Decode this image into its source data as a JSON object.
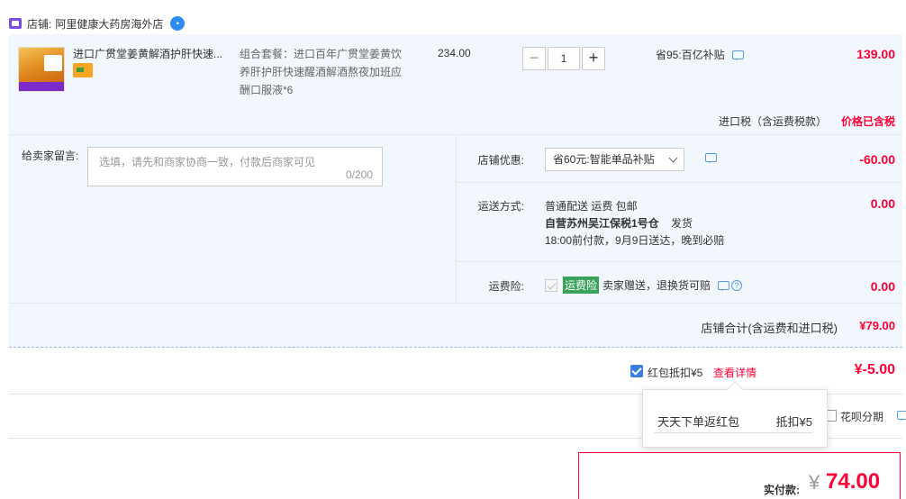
{
  "shop": {
    "prefix": "店铺:",
    "name": "阿里健康大药房海外店"
  },
  "item": {
    "title": "进口广贯堂姜黄解酒护肝快速...",
    "sku": "组合套餐：进口百年广贯堂姜黄饮养肝护肝快速醒酒解酒熬夜加班应酬口服液*6",
    "unit_price": "234.00",
    "quantity": "1",
    "qty_minus": "−",
    "qty_plus": "+",
    "saving": "省95:百亿补贴",
    "total": "139.00",
    "tax_label": "进口税（含运费税款）",
    "tax_value": "价格已含税"
  },
  "message": {
    "label": "给卖家留言:",
    "placeholder": "选填，请先和商家协商一致，付款后商家可见",
    "count": "0/200"
  },
  "discount": {
    "label": "店铺优惠:",
    "selected": "省60元:智能单品补贴",
    "amount": "-60.00"
  },
  "shipping": {
    "label": "运送方式:",
    "line1": "普通配送 运费 包邮",
    "line2": "自营苏州吴江保税1号仓",
    "line2_suffix": "发货",
    "line3": "18:00前付款，9月9日送达，晚到必赔",
    "amount": "0.00"
  },
  "insurance": {
    "label": "运费险:",
    "tag": "运费险",
    "text": "卖家赠送，退换货可赔",
    "amount": "0.00"
  },
  "subtotal": {
    "label": "店铺合计(含运费和进口税)",
    "value": "¥79.00"
  },
  "redpack": {
    "label": "红包抵扣¥5",
    "link": "查看详情",
    "value": "¥-5.00",
    "popover_name": "天天下单返红包",
    "popover_value": "抵扣¥5"
  },
  "installment": {
    "label": "花呗分期"
  },
  "payment": {
    "label": "实付款:",
    "currency": "¥",
    "value": "74.00"
  },
  "colors": {
    "accent_red": "#ff0036",
    "panel_blue": "#f2f6fd",
    "check_blue": "#3b7de0"
  }
}
